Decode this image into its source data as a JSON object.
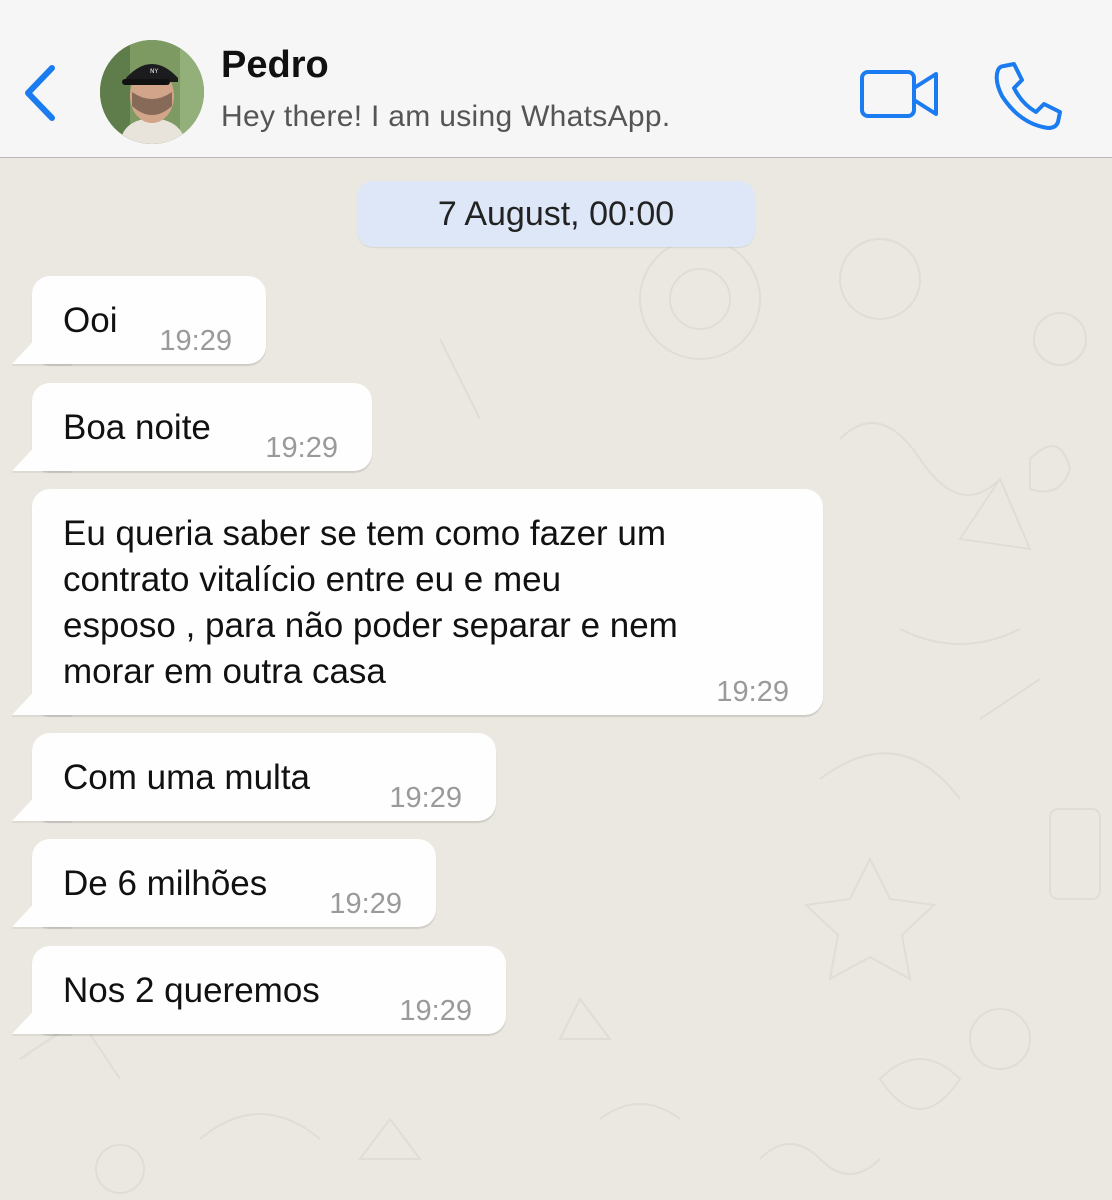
{
  "header": {
    "back_icon": "chevron-left-icon",
    "contact_name": "Pedro",
    "contact_status": "Hey there! I am using WhatsApp.",
    "video_icon": "video-camera-icon",
    "call_icon": "phone-icon",
    "accent_color": "#1a7cf0"
  },
  "chat": {
    "date_label": "7 August, 00:00",
    "messages": [
      {
        "text": "Ooi",
        "time": "19:29"
      },
      {
        "text": "Boa noite",
        "time": "19:29"
      },
      {
        "text": "Eu queria saber se tem como fazer um\ncontrato vitalício entre eu e meu\nesposo , para não poder separar e nem\nmorar em outra casa",
        "time": "19:29"
      },
      {
        "text": "Com uma multa",
        "time": "19:29"
      },
      {
        "text": "De 6 milhões",
        "time": "19:29"
      },
      {
        "text": "Nos 2 queremos",
        "time": "19:29"
      }
    ]
  }
}
